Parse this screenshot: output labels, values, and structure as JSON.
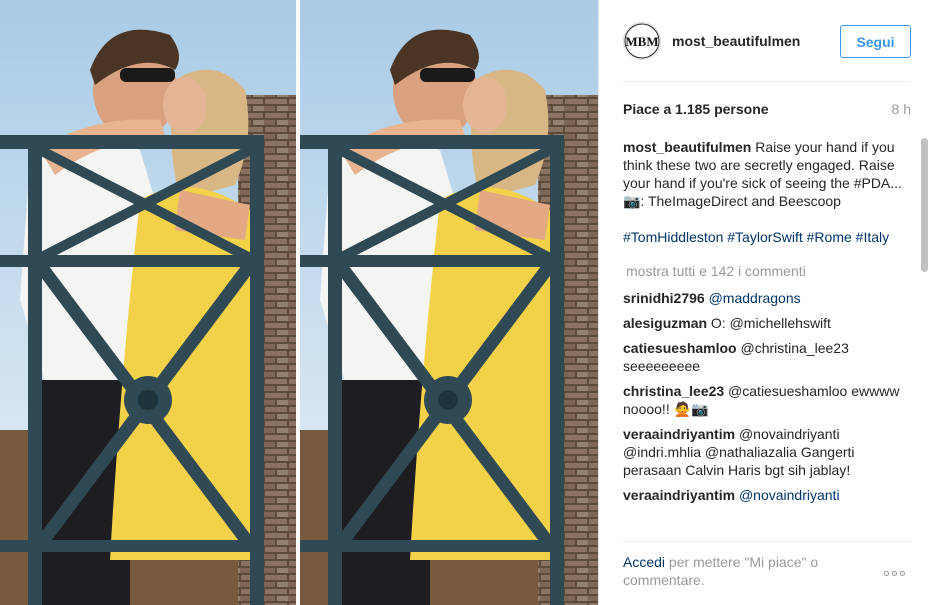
{
  "colors": {
    "accent": "#3897f0",
    "link": "#003569",
    "muted": "#999999"
  },
  "post": {
    "username": "most_beautifulmen",
    "avatar_initials": "MBM",
    "follow_label": "Segui",
    "likes": "Piace a 1.185 persone",
    "time": "8 h",
    "caption_text": "Raise your hand if you think these two are secretly engaged. Raise your hand if you're sick of seeing the #PDA... 📷: TheImageDirect and Beescoop",
    "hashtags": "#TomHiddleston #TaylorSwift #Rome #Italy",
    "load_more": "mostra tutti e 142 i commenti"
  },
  "comments": [
    {
      "user": "srinidhi2796",
      "text": "@maddragons"
    },
    {
      "user": "alesiguzman",
      "text": "O: @michellehswift"
    },
    {
      "user": "catiesueshamloo",
      "text": "@christina_lee23 seeeeeeeee"
    },
    {
      "user": "christina_lee23",
      "text": "@catiesueshamloo ewwww noooo!! 🙅📷"
    },
    {
      "user": "veraaindriyantim",
      "text": "@novaindriyanti @indri.mhlia @nathaliazalia Gangerti perasaan Calvin Haris bgt sih jablay!"
    },
    {
      "user": "veraaindriyantim",
      "text": "@novaindriyanti"
    }
  ],
  "footer": {
    "login_link": "Accedi",
    "login_text": " per mettere \"Mi piace\" o commentare."
  },
  "icons": {
    "more": "more-options-icon",
    "photo": "post-photo"
  }
}
